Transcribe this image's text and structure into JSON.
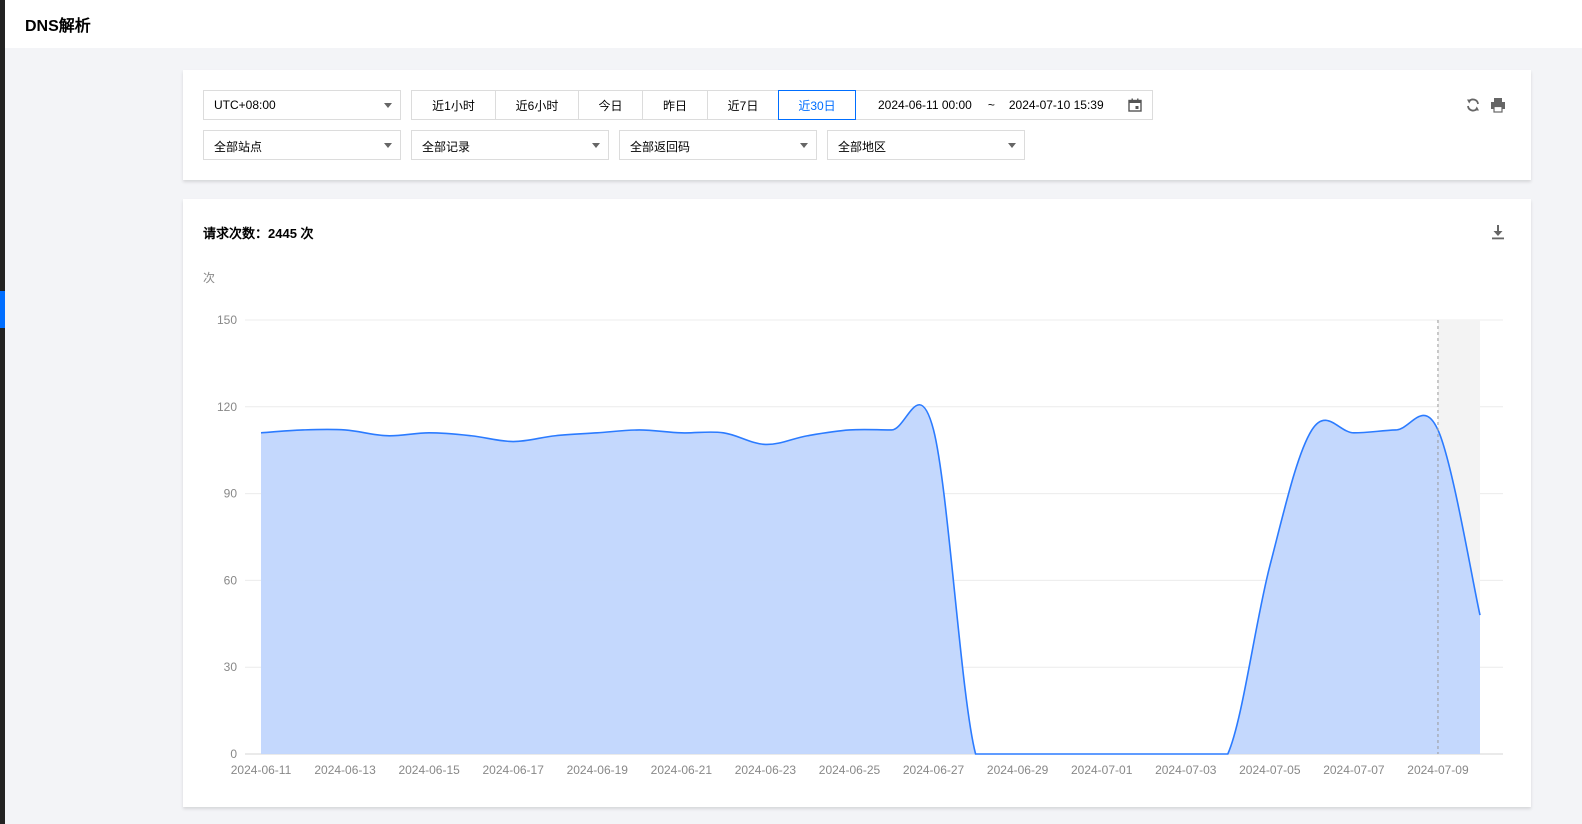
{
  "page": {
    "title": "DNS解析"
  },
  "filters": {
    "timezone": "UTC+08:00",
    "quick_ranges": [
      "近1小时",
      "近6小时",
      "今日",
      "昨日",
      "近7日",
      "近30日"
    ],
    "active_range": "近30日",
    "date_start": "2024-06-11 00:00",
    "date_sep": "~",
    "date_end": "2024-07-10 15:39",
    "site": "全部站点",
    "record": "全部记录",
    "return_code": "全部返回码",
    "region": "全部地区"
  },
  "icons": {
    "refresh": "refresh-icon",
    "print": "print-icon",
    "calendar": "calendar-icon",
    "download": "download-icon"
  },
  "colors": {
    "accent": "#006eff",
    "line": "#2b7bff",
    "area": "#c1d6fd"
  },
  "summary": {
    "label": "请求次数：",
    "value": "2445 次"
  },
  "chart_data": {
    "type": "area",
    "ylabel": "次",
    "ylim": [
      0,
      150
    ],
    "yticks": [
      0,
      30,
      60,
      90,
      120,
      150
    ],
    "grid": true,
    "xtick_labels": [
      "2024-06-11",
      "2024-06-13",
      "2024-06-15",
      "2024-06-17",
      "2024-06-19",
      "2024-06-21",
      "2024-06-23",
      "2024-06-25",
      "2024-06-27",
      "2024-06-29",
      "2024-07-01",
      "2024-07-03",
      "2024-07-05",
      "2024-07-07",
      "2024-07-09"
    ],
    "x": [
      "2024-06-11",
      "2024-06-12",
      "2024-06-13",
      "2024-06-14",
      "2024-06-15",
      "2024-06-16",
      "2024-06-17",
      "2024-06-18",
      "2024-06-19",
      "2024-06-20",
      "2024-06-21",
      "2024-06-22",
      "2024-06-23",
      "2024-06-24",
      "2024-06-25",
      "2024-06-26",
      "2024-06-27",
      "2024-06-28",
      "2024-06-29",
      "2024-06-30",
      "2024-07-01",
      "2024-07-02",
      "2024-07-03",
      "2024-07-04",
      "2024-07-05",
      "2024-07-06",
      "2024-07-07",
      "2024-07-08",
      "2024-07-09",
      "2024-07-10"
    ],
    "values": [
      111,
      112,
      112,
      110,
      111,
      110,
      108,
      110,
      111,
      112,
      111,
      111,
      107,
      110,
      112,
      112,
      112,
      0,
      0,
      0,
      0,
      0,
      0,
      0,
      65,
      112,
      111,
      112,
      112,
      48
    ],
    "highlight_x": "2024-07-09"
  }
}
